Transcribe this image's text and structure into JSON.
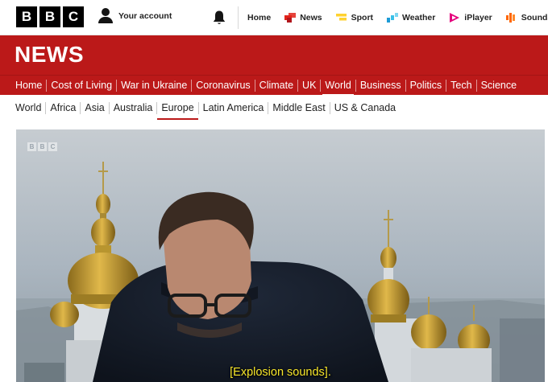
{
  "header": {
    "logo_letters": [
      "B",
      "B",
      "C"
    ],
    "account_label": "Your account",
    "nav": [
      {
        "label": "Home",
        "icon": "none"
      },
      {
        "label": "News",
        "icon": "news-icon",
        "color": "#e2231a"
      },
      {
        "label": "Sport",
        "icon": "sport-icon",
        "color": "#ffd230"
      },
      {
        "label": "Weather",
        "icon": "weather-icon",
        "color": "#1d9bd6"
      },
      {
        "label": "iPlayer",
        "icon": "iplayer-icon",
        "color": "#e4007c"
      },
      {
        "label": "Sounds",
        "icon": "sounds-icon",
        "color": "#ff6600"
      }
    ]
  },
  "masthead": {
    "title": "NEWS",
    "background": "#bb1919"
  },
  "main_nav": {
    "items": [
      "Home",
      "Cost of Living",
      "War in Ukraine",
      "Coronavirus",
      "Climate",
      "UK",
      "World",
      "Business",
      "Politics",
      "Tech",
      "Science"
    ],
    "active": "World"
  },
  "sub_nav": {
    "items": [
      "World",
      "Africa",
      "Asia",
      "Australia",
      "Europe",
      "Latin America",
      "Middle East",
      "US & Canada"
    ],
    "active": "Europe"
  },
  "video": {
    "watermark_letters": [
      "B",
      "B",
      "C"
    ],
    "caption": "[Explosion sounds]."
  }
}
